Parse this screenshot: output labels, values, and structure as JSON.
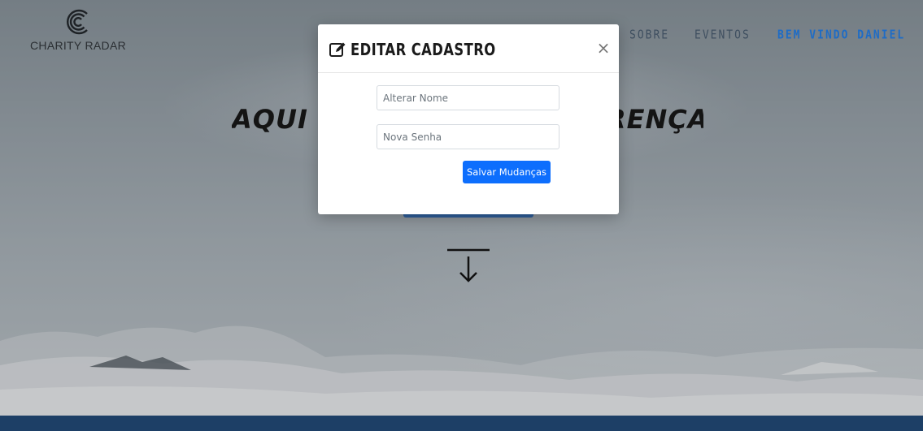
{
  "brand": {
    "name": "CHARITY RADAR"
  },
  "nav": {
    "items": [
      {
        "label": "SOBRE"
      },
      {
        "label": "EVENTOS"
      }
    ],
    "user_label": "BEM VINDO DANIEL"
  },
  "hero": {
    "title_left": "AQUI V",
    "title_right": "RENÇA!"
  },
  "modal": {
    "title": "EDITAR CADASTRO",
    "close_glyph": "×",
    "name_placeholder": "Alterar Nome",
    "password_placeholder": "Nova Senha",
    "save_label": "Salvar Mudanças"
  },
  "colors": {
    "accent": "#0d6efd",
    "nav_user": "#1e6cc6",
    "bottom_bar": "#1d3f66"
  },
  "icons": {
    "logo": "concentric-c-icon",
    "edit": "edit-square-icon",
    "close": "close-icon",
    "scroll": "scroll-down-arrow-icon"
  }
}
